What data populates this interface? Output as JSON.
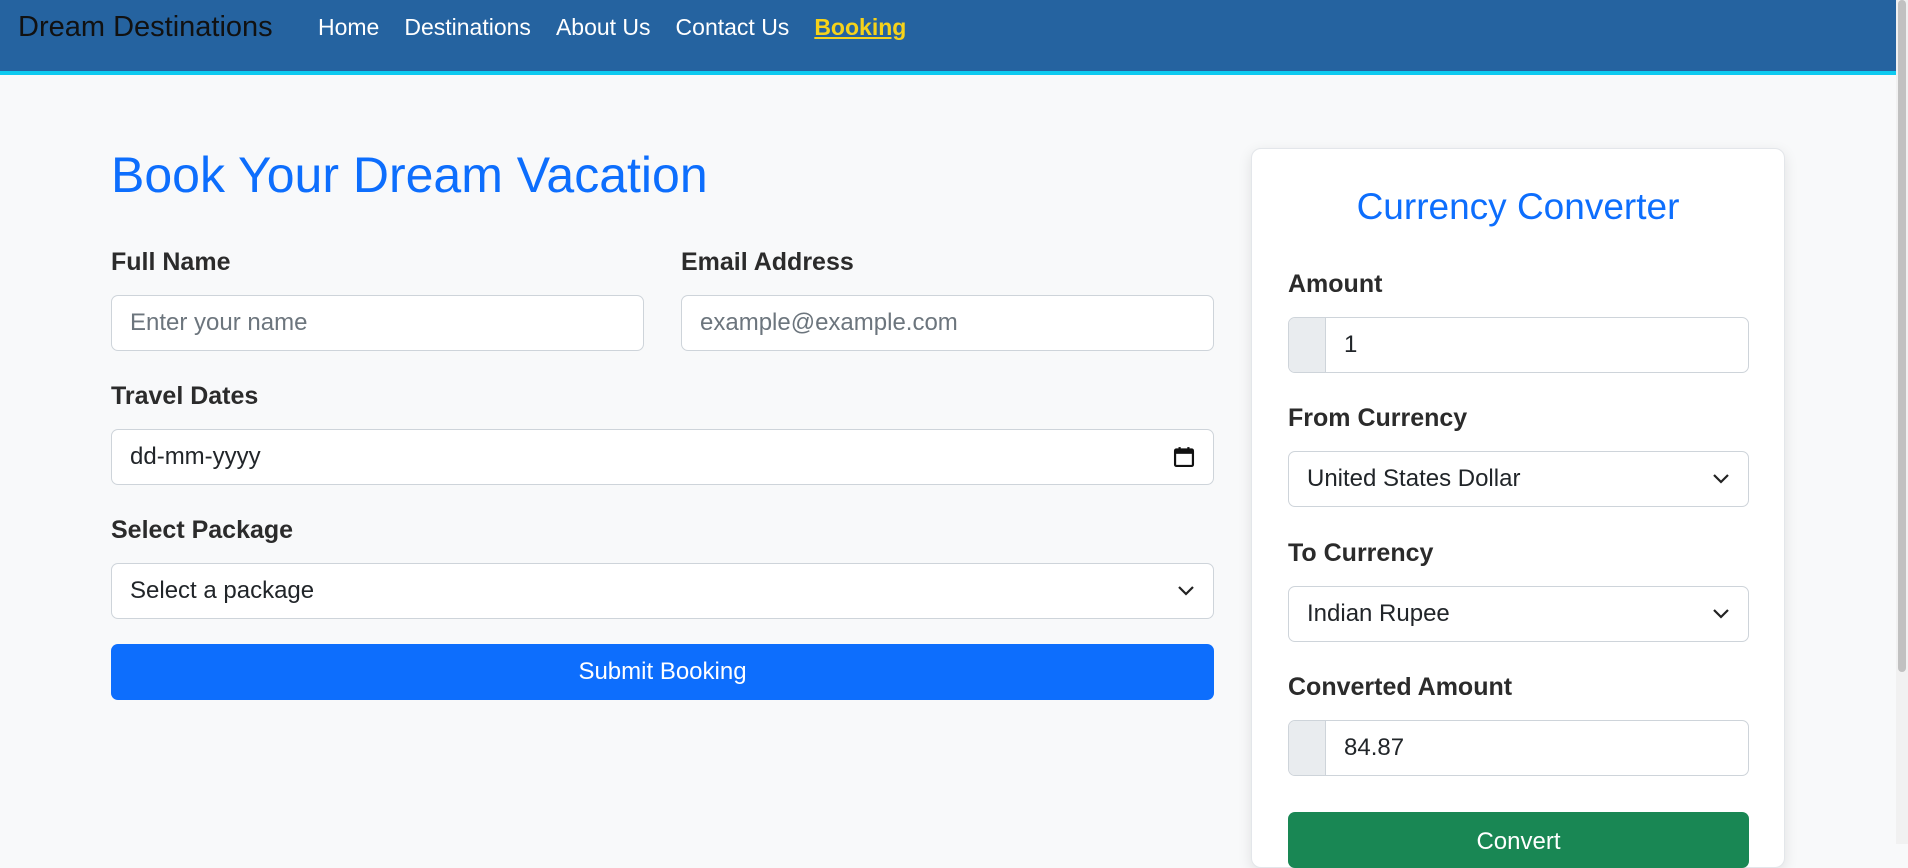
{
  "navbar": {
    "brand": "Dream Destinations",
    "links": [
      {
        "label": "Home"
      },
      {
        "label": "Destinations"
      },
      {
        "label": "About Us"
      },
      {
        "label": "Contact Us"
      },
      {
        "label": "Booking",
        "active": true
      }
    ]
  },
  "booking": {
    "title": "Book Your Dream Vacation",
    "full_name": {
      "label": "Full Name",
      "placeholder": "Enter your name",
      "value": ""
    },
    "email": {
      "label": "Email Address",
      "placeholder": "example@example.com",
      "value": ""
    },
    "travel_dates": {
      "label": "Travel Dates",
      "placeholder": "dd-mm-yyyy"
    },
    "package": {
      "label": "Select Package",
      "selected": "Select a package"
    },
    "submit_label": "Submit Booking"
  },
  "converter": {
    "title": "Currency Converter",
    "amount": {
      "label": "Amount",
      "value": "1"
    },
    "from": {
      "label": "From Currency",
      "selected": "United States Dollar"
    },
    "to": {
      "label": "To Currency",
      "selected": "Indian Rupee"
    },
    "converted": {
      "label": "Converted Amount",
      "value": "84.87"
    },
    "convert_label": "Convert"
  },
  "colors": {
    "nav_bg": "#2563a0",
    "nav_border": "#0dcaf0",
    "accent": "#0d6efd",
    "active_link": "#f6d21a",
    "success": "#198754"
  },
  "icons": [
    "calendar-icon",
    "chevron-down-icon"
  ]
}
